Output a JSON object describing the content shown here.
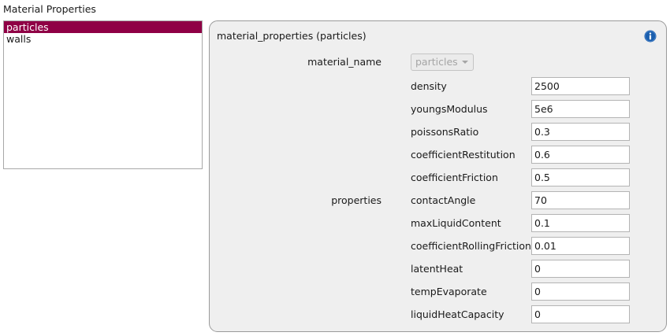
{
  "window": {
    "section_title": "Material Properties"
  },
  "material_list": {
    "items": [
      {
        "label": "particles",
        "selected": true
      },
      {
        "label": "walls",
        "selected": false
      }
    ],
    "selected_color": "#8f0045"
  },
  "panel": {
    "title": "material_properties (particles)",
    "info_icon": "info-icon",
    "info_color": "#1b5fae",
    "material_name_label": "material_name",
    "material_name_value": "particles",
    "properties_label": "properties",
    "properties": [
      {
        "name": "density",
        "value": "2500"
      },
      {
        "name": "youngsModulus",
        "value": "5e6"
      },
      {
        "name": "poissonsRatio",
        "value": "0.3"
      },
      {
        "name": "coefficientRestitution",
        "value": "0.6"
      },
      {
        "name": "coefficientFriction",
        "value": "0.5"
      },
      {
        "name": "contactAngle",
        "value": "70"
      },
      {
        "name": "maxLiquidContent",
        "value": "0.1"
      },
      {
        "name": "coefficientRollingFriction",
        "value": "0.01"
      },
      {
        "name": "latentHeat",
        "value": "0"
      },
      {
        "name": "tempEvaporate",
        "value": "0"
      },
      {
        "name": "liquidHeatCapacity",
        "value": "0"
      }
    ]
  }
}
